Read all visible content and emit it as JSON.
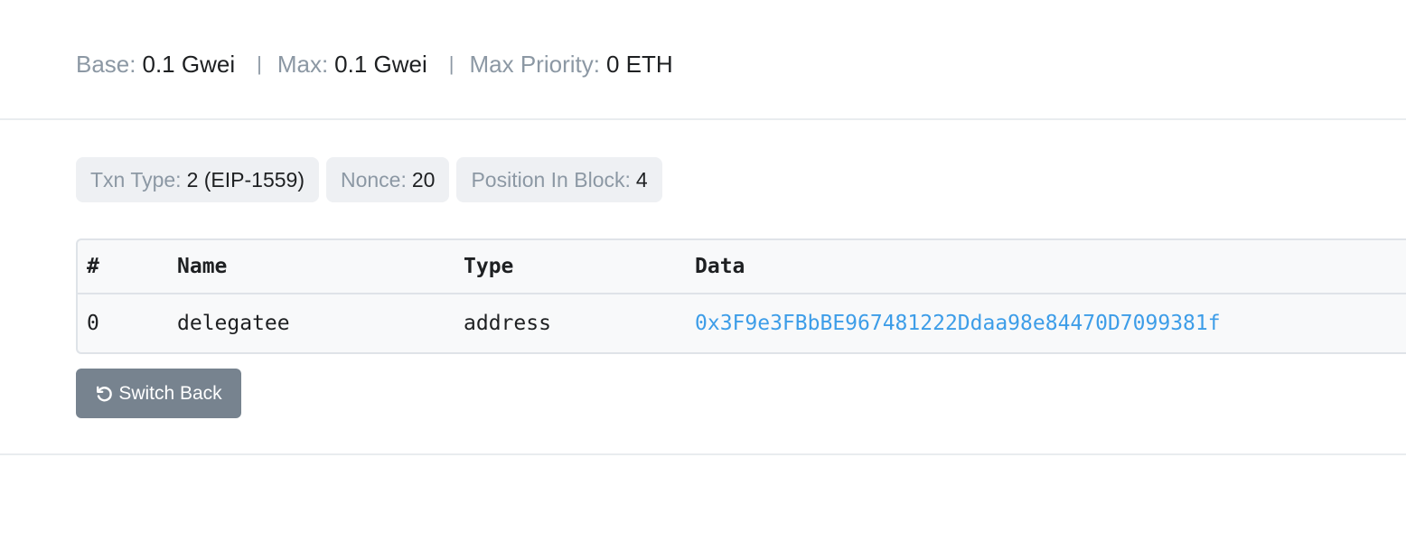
{
  "gas_fees": {
    "base_label": "Base:",
    "base_value": "0.1 Gwei",
    "max_label": "Max:",
    "max_value": "0.1 Gwei",
    "max_priority_label": "Max Priority:",
    "max_priority_value": "0 ETH",
    "separator": "|"
  },
  "attributes": {
    "txn_type_label": "Txn Type:",
    "txn_type_value": "2 (EIP-1559)",
    "nonce_label": "Nonce:",
    "nonce_value": "20",
    "position_label": "Position In Block:",
    "position_value": "4"
  },
  "input_data_table": {
    "headers": [
      "#",
      "Name",
      "Type",
      "Data"
    ],
    "rows": [
      {
        "index": "0",
        "name": "delegatee",
        "type": "address",
        "data": "0x3F9e3FBbBE967481222Ddaa98e84470D7099381f"
      }
    ]
  },
  "actions": {
    "switch_back_label": "Switch Back",
    "switch_back_icon": "undo-icon"
  },
  "colors": {
    "link": "#3d9de8",
    "button_bg": "#77838f",
    "muted_label": "#8c98a4"
  }
}
